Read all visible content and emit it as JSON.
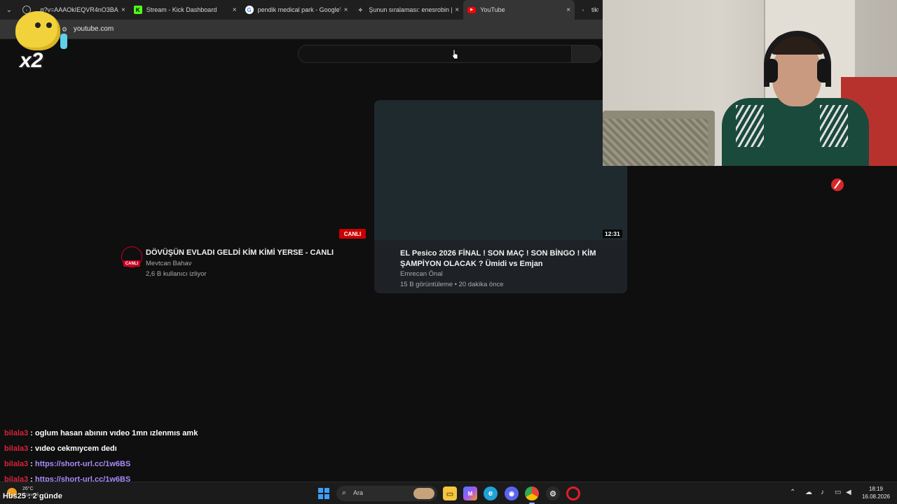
{
  "browser": {
    "tabs": [
      {
        "title": "...q?v=AAAOkIEQVR4nO3BAQ",
        "favicon": "globe-icon",
        "active": false
      },
      {
        "title": "Stream - Kick Dashboard",
        "favicon": "kick-icon",
        "active": false
      },
      {
        "title": "pendik medical park - Google'd",
        "favicon": "google-icon",
        "active": false
      },
      {
        "title": "Şunun sıralaması: enesrobin | Ya",
        "favicon": "settings-icon",
        "active": false
      },
      {
        "title": "YouTube",
        "favicon": "youtube-icon",
        "active": true
      },
      {
        "title": "tikto",
        "favicon": "tiktok-icon",
        "active": false
      }
    ],
    "close_glyph": "×",
    "address": "youtube.com"
  },
  "overlay_sticker": {
    "multiplier": "x2"
  },
  "youtube": {
    "search_placeholder": "",
    "videos": [
      {
        "title": "DÖVÜŞÜN EVLADI GELDİ KİM KİMİ YERSE - CANLI",
        "channel": "Mevtcan Bahav",
        "meta": "2,6 B kullanıcı izliyor",
        "badge": "CANLI",
        "avatar_badge": "CANLI"
      },
      {
        "title": "EL Pesico 2026 FİNAL ! SON MAÇ ! SON BİNGO ! KİM ŞAMPİYON OLACAK ? Ümidi vs Emjan",
        "channel": "Emrecan Önal",
        "meta": "15 B görüntüleme • 20 dakika önce",
        "duration": "12:31"
      }
    ]
  },
  "chat": {
    "messages": [
      {
        "user": "bilala3",
        "sep": " : ",
        "text": "oglum hasan abının vıdeo 1mn ızlenmıs amk",
        "is_link": false
      },
      {
        "user": "bilala3",
        "sep": " : ",
        "text": "vıdeo cekmıycem dedı",
        "is_link": false
      },
      {
        "user": "bilala3",
        "sep": " : ",
        "text": "https://short-url.cc/1w6BS",
        "is_link": true
      },
      {
        "user": "bilala3",
        "sep": " : ",
        "text": "https://short-url.cc/1w6BS",
        "is_link": true
      }
    ]
  },
  "taskbar": {
    "weather_temp": "26°C",
    "weather_condition": "Güneşli",
    "overlay_text": "Hbs25 : 2 günde",
    "search_label": "Ara",
    "apps": [
      "file-explorer-icon",
      "m365-icon",
      "edge-icon",
      "discord-icon",
      "chrome-icon",
      "steam-icon",
      "opera-icon"
    ],
    "tray_icons": [
      "chevron-up-icon",
      "network-icon",
      "mic-icon",
      "display-icon",
      "volume-icon"
    ],
    "time": "18:19",
    "date": "16.08.2026"
  },
  "colors": {
    "youtube_red": "#cc0000",
    "chat_user": "#d8223a",
    "chat_link": "#a78bfa",
    "background": "#0f0f0f"
  }
}
